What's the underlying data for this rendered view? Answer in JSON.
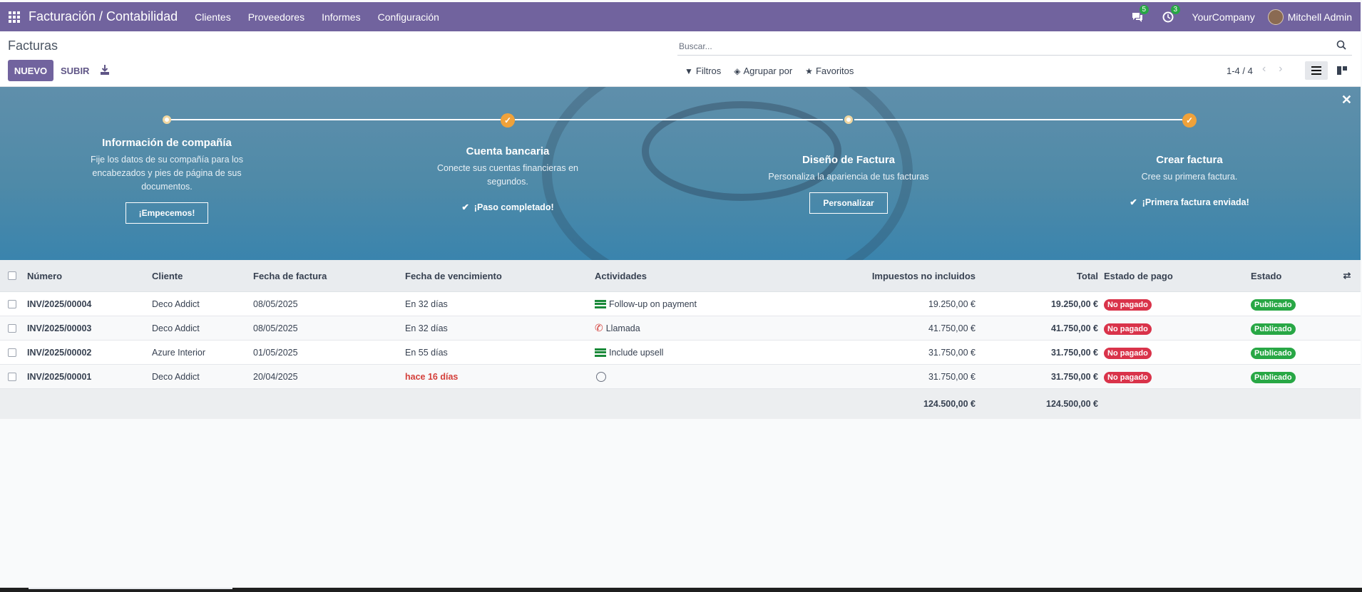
{
  "topbar": {
    "app_title": "Facturación / Contabilidad",
    "menu": [
      "Clientes",
      "Proveedores",
      "Informes",
      "Configuración"
    ],
    "messages_count": "5",
    "activities_count": "3",
    "company": "YourCompany",
    "user": "Mitchell Admin"
  },
  "control_panel": {
    "title": "Facturas",
    "new_label": "NUEVO",
    "upload_label": "SUBIR",
    "search_placeholder": "Buscar...",
    "filters_label": "Filtros",
    "group_by_label": "Agrupar por",
    "favorites_label": "Favoritos",
    "pager": "1-4 / 4"
  },
  "banner": {
    "steps": [
      {
        "title": "Información de compañía",
        "text": "Fije los datos de su compañía para los encabezados y pies de página de sus documentos.",
        "button": "¡Empecemos!"
      },
      {
        "title": "Cuenta bancaria",
        "text": "Conecte sus cuentas financieras en segundos.",
        "done": "¡Paso completado!"
      },
      {
        "title": "Diseño de Factura",
        "text": "Personaliza la apariencia de tus facturas",
        "button": "Personalizar"
      },
      {
        "title": "Crear factura",
        "text": "Cree su primera factura.",
        "done": "¡Primera factura enviada!"
      }
    ]
  },
  "table": {
    "headers": {
      "number": "Número",
      "client": "Cliente",
      "date": "Fecha de factura",
      "due": "Fecha de vencimiento",
      "activities": "Actividades",
      "tax_excluded": "Impuestos no incluidos",
      "total": "Total",
      "payment_state": "Estado de pago",
      "state": "Estado"
    },
    "rows": [
      {
        "number": "INV/2025/00004",
        "client": "Deco Addict",
        "date": "08/05/2025",
        "due": "En 32 días",
        "activity": "Follow-up on payment",
        "tax_excluded": "19.250,00 €",
        "total": "19.250,00 €",
        "payment": "No pagado",
        "state": "Publicado"
      },
      {
        "number": "INV/2025/00003",
        "client": "Deco Addict",
        "date": "08/05/2025",
        "due": "En 32 días",
        "activity": "Llamada",
        "tax_excluded": "41.750,00 €",
        "total": "41.750,00 €",
        "payment": "No pagado",
        "state": "Publicado"
      },
      {
        "number": "INV/2025/00002",
        "client": "Azure Interior",
        "date": "01/05/2025",
        "due": "En 55 días",
        "activity": "Include upsell",
        "tax_excluded": "31.750,00 €",
        "total": "31.750,00 €",
        "payment": "No pagado",
        "state": "Publicado"
      },
      {
        "number": "INV/2025/00001",
        "client": "Deco Addict",
        "date": "20/04/2025",
        "due": "hace 16 días",
        "activity": "",
        "tax_excluded": "31.750,00 €",
        "total": "31.750,00 €",
        "payment": "No pagado",
        "state": "Publicado"
      }
    ],
    "footer": {
      "tax_excluded": "124.500,00 €",
      "total": "124.500,00 €"
    }
  }
}
